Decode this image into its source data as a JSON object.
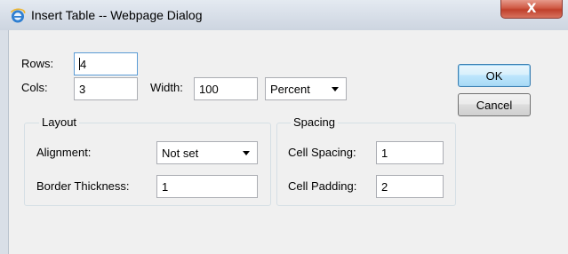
{
  "window": {
    "title": "Insert Table -- Webpage Dialog",
    "close_label": "X",
    "app_icon": "internet-explorer-icon"
  },
  "fields": {
    "rows": {
      "label": "Rows:",
      "value": "4"
    },
    "cols": {
      "label": "Cols:",
      "value": "3"
    },
    "width": {
      "label": "Width:",
      "value": "100"
    },
    "width_unit": {
      "selected": "Percent"
    }
  },
  "buttons": {
    "ok": "OK",
    "cancel": "Cancel"
  },
  "layout_group": {
    "title": "Layout",
    "alignment": {
      "label": "Alignment:",
      "selected": "Not set"
    },
    "border_thickness": {
      "label": "Border Thickness:",
      "value": "1"
    }
  },
  "spacing_group": {
    "title": "Spacing",
    "cell_spacing": {
      "label": "Cell Spacing:",
      "value": "1"
    },
    "cell_padding": {
      "label": "Cell Padding:",
      "value": "2"
    }
  },
  "colors": {
    "titlebar": "#d6dde7",
    "close_button": "#c0402b",
    "dialog_background": "#f0f0f0",
    "focus_border": "#5a9bd5"
  }
}
